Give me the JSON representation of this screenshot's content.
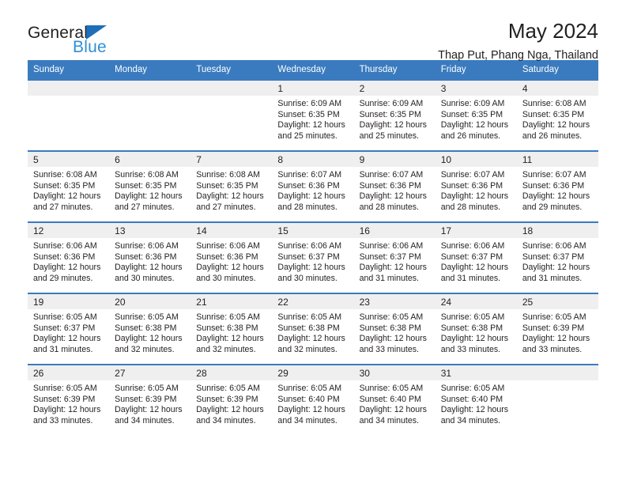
{
  "brand": {
    "name_part1": "General",
    "name_part2": "Blue",
    "triangle_icon": "blue-triangle-icon",
    "accent_color": "#2e8fd6"
  },
  "header": {
    "title": "May 2024",
    "location": "Thap Put, Phang Nga, Thailand"
  },
  "calendar": {
    "header_bg": "#3a7bbf",
    "daynum_bg": "#efefef",
    "weekday_headers": [
      "Sunday",
      "Monday",
      "Tuesday",
      "Wednesday",
      "Thursday",
      "Friday",
      "Saturday"
    ],
    "weeks": [
      [
        {
          "day": "",
          "lines": []
        },
        {
          "day": "",
          "lines": []
        },
        {
          "day": "",
          "lines": []
        },
        {
          "day": "1",
          "lines": [
            "Sunrise: 6:09 AM",
            "Sunset: 6:35 PM",
            "Daylight: 12 hours",
            "and 25 minutes."
          ]
        },
        {
          "day": "2",
          "lines": [
            "Sunrise: 6:09 AM",
            "Sunset: 6:35 PM",
            "Daylight: 12 hours",
            "and 25 minutes."
          ]
        },
        {
          "day": "3",
          "lines": [
            "Sunrise: 6:09 AM",
            "Sunset: 6:35 PM",
            "Daylight: 12 hours",
            "and 26 minutes."
          ]
        },
        {
          "day": "4",
          "lines": [
            "Sunrise: 6:08 AM",
            "Sunset: 6:35 PM",
            "Daylight: 12 hours",
            "and 26 minutes."
          ]
        }
      ],
      [
        {
          "day": "5",
          "lines": [
            "Sunrise: 6:08 AM",
            "Sunset: 6:35 PM",
            "Daylight: 12 hours",
            "and 27 minutes."
          ]
        },
        {
          "day": "6",
          "lines": [
            "Sunrise: 6:08 AM",
            "Sunset: 6:35 PM",
            "Daylight: 12 hours",
            "and 27 minutes."
          ]
        },
        {
          "day": "7",
          "lines": [
            "Sunrise: 6:08 AM",
            "Sunset: 6:35 PM",
            "Daylight: 12 hours",
            "and 27 minutes."
          ]
        },
        {
          "day": "8",
          "lines": [
            "Sunrise: 6:07 AM",
            "Sunset: 6:36 PM",
            "Daylight: 12 hours",
            "and 28 minutes."
          ]
        },
        {
          "day": "9",
          "lines": [
            "Sunrise: 6:07 AM",
            "Sunset: 6:36 PM",
            "Daylight: 12 hours",
            "and 28 minutes."
          ]
        },
        {
          "day": "10",
          "lines": [
            "Sunrise: 6:07 AM",
            "Sunset: 6:36 PM",
            "Daylight: 12 hours",
            "and 28 minutes."
          ]
        },
        {
          "day": "11",
          "lines": [
            "Sunrise: 6:07 AM",
            "Sunset: 6:36 PM",
            "Daylight: 12 hours",
            "and 29 minutes."
          ]
        }
      ],
      [
        {
          "day": "12",
          "lines": [
            "Sunrise: 6:06 AM",
            "Sunset: 6:36 PM",
            "Daylight: 12 hours",
            "and 29 minutes."
          ]
        },
        {
          "day": "13",
          "lines": [
            "Sunrise: 6:06 AM",
            "Sunset: 6:36 PM",
            "Daylight: 12 hours",
            "and 30 minutes."
          ]
        },
        {
          "day": "14",
          "lines": [
            "Sunrise: 6:06 AM",
            "Sunset: 6:36 PM",
            "Daylight: 12 hours",
            "and 30 minutes."
          ]
        },
        {
          "day": "15",
          "lines": [
            "Sunrise: 6:06 AM",
            "Sunset: 6:37 PM",
            "Daylight: 12 hours",
            "and 30 minutes."
          ]
        },
        {
          "day": "16",
          "lines": [
            "Sunrise: 6:06 AM",
            "Sunset: 6:37 PM",
            "Daylight: 12 hours",
            "and 31 minutes."
          ]
        },
        {
          "day": "17",
          "lines": [
            "Sunrise: 6:06 AM",
            "Sunset: 6:37 PM",
            "Daylight: 12 hours",
            "and 31 minutes."
          ]
        },
        {
          "day": "18",
          "lines": [
            "Sunrise: 6:06 AM",
            "Sunset: 6:37 PM",
            "Daylight: 12 hours",
            "and 31 minutes."
          ]
        }
      ],
      [
        {
          "day": "19",
          "lines": [
            "Sunrise: 6:05 AM",
            "Sunset: 6:37 PM",
            "Daylight: 12 hours",
            "and 31 minutes."
          ]
        },
        {
          "day": "20",
          "lines": [
            "Sunrise: 6:05 AM",
            "Sunset: 6:38 PM",
            "Daylight: 12 hours",
            "and 32 minutes."
          ]
        },
        {
          "day": "21",
          "lines": [
            "Sunrise: 6:05 AM",
            "Sunset: 6:38 PM",
            "Daylight: 12 hours",
            "and 32 minutes."
          ]
        },
        {
          "day": "22",
          "lines": [
            "Sunrise: 6:05 AM",
            "Sunset: 6:38 PM",
            "Daylight: 12 hours",
            "and 32 minutes."
          ]
        },
        {
          "day": "23",
          "lines": [
            "Sunrise: 6:05 AM",
            "Sunset: 6:38 PM",
            "Daylight: 12 hours",
            "and 33 minutes."
          ]
        },
        {
          "day": "24",
          "lines": [
            "Sunrise: 6:05 AM",
            "Sunset: 6:38 PM",
            "Daylight: 12 hours",
            "and 33 minutes."
          ]
        },
        {
          "day": "25",
          "lines": [
            "Sunrise: 6:05 AM",
            "Sunset: 6:39 PM",
            "Daylight: 12 hours",
            "and 33 minutes."
          ]
        }
      ],
      [
        {
          "day": "26",
          "lines": [
            "Sunrise: 6:05 AM",
            "Sunset: 6:39 PM",
            "Daylight: 12 hours",
            "and 33 minutes."
          ]
        },
        {
          "day": "27",
          "lines": [
            "Sunrise: 6:05 AM",
            "Sunset: 6:39 PM",
            "Daylight: 12 hours",
            "and 34 minutes."
          ]
        },
        {
          "day": "28",
          "lines": [
            "Sunrise: 6:05 AM",
            "Sunset: 6:39 PM",
            "Daylight: 12 hours",
            "and 34 minutes."
          ]
        },
        {
          "day": "29",
          "lines": [
            "Sunrise: 6:05 AM",
            "Sunset: 6:40 PM",
            "Daylight: 12 hours",
            "and 34 minutes."
          ]
        },
        {
          "day": "30",
          "lines": [
            "Sunrise: 6:05 AM",
            "Sunset: 6:40 PM",
            "Daylight: 12 hours",
            "and 34 minutes."
          ]
        },
        {
          "day": "31",
          "lines": [
            "Sunrise: 6:05 AM",
            "Sunset: 6:40 PM",
            "Daylight: 12 hours",
            "and 34 minutes."
          ]
        },
        {
          "day": "",
          "lines": []
        }
      ]
    ]
  }
}
